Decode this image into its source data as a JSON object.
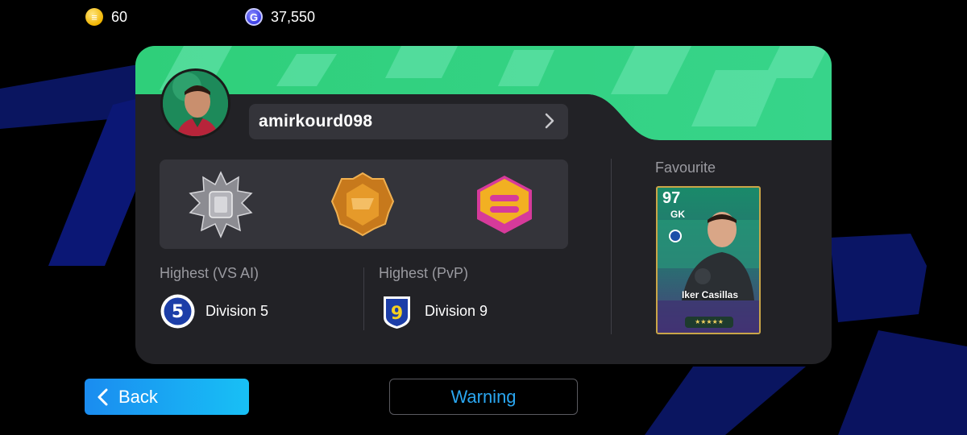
{
  "currency": {
    "gold": {
      "icon": "gold-coin-icon",
      "value": "60"
    },
    "gp": {
      "icon": "gp-coin-icon",
      "value": "37,550"
    }
  },
  "profile": {
    "username": "amirkourd098",
    "avatar_icon": "player-avatar"
  },
  "division": {
    "vs_ai": {
      "label": "Highest (VS AI)",
      "badge_number": "5",
      "value": "Division 5"
    },
    "pvp": {
      "label": "Highest (PvP)",
      "badge_number": "9",
      "value": "Division 9"
    }
  },
  "favourite": {
    "label": "Favourite",
    "player": {
      "rating": "97",
      "position": "GK",
      "name": "Iker Casillas"
    }
  },
  "buttons": {
    "back": "Back",
    "warning": "Warning"
  },
  "colors": {
    "accent_green": "#2fd184",
    "accent_blue": "#1a8cf0",
    "card_bg": "#222226",
    "panel_bg": "#34343a"
  }
}
